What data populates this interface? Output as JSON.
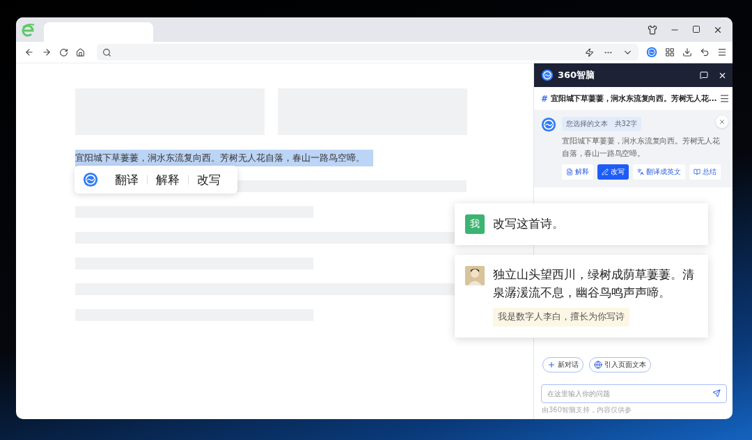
{
  "page": {
    "selected_text": "宜阳城下草萋萋，涧水东流复向西。芳树无人花自落，春山一路鸟空啼。",
    "popup": {
      "actions": [
        "翻译",
        "解释",
        "改写"
      ]
    }
  },
  "assistant": {
    "brand": "360智脑",
    "hash": "#",
    "conversation_title": "宜阳城下草萋萋，涧水东流复向西。芳树无人花...",
    "selection": {
      "label": "您选择的文本",
      "count": "共32字",
      "text": "宜阳城下草萋萋，涧水东流复向西。芳树无人花自落，春山一路鸟空啼。",
      "actions": [
        {
          "label": "解释",
          "selected": false
        },
        {
          "label": "改写",
          "selected": true
        },
        {
          "label": "翻译成英文",
          "selected": false
        },
        {
          "label": "总结",
          "selected": false
        }
      ]
    },
    "messages": [
      {
        "kind": "user",
        "avatar": "我",
        "text": "改写这首诗。"
      },
      {
        "kind": "bot",
        "text": "独立山头望西川，绿树成荫草萋萋。清泉潺湲流不息，幽谷鸟鸣声声啼。",
        "note": "我是数字人李白，擅长为你写诗"
      }
    ],
    "quick_actions": [
      "新对话",
      "引入页面文本"
    ],
    "input": {
      "placeholder": "在这里输入你的问题"
    },
    "footer": "由360智脑支持，内容仅供参"
  }
}
